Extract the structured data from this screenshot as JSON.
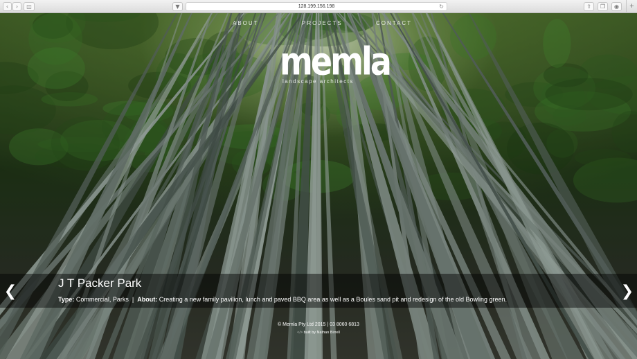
{
  "browser": {
    "url": "128.199.156.198",
    "icons": {
      "back": "chevron-left-icon",
      "forward": "chevron-right-icon",
      "sidebar": "sidebar-icon",
      "shield": "shield-icon",
      "reload": "reload-icon",
      "share": "share-icon",
      "tabs": "tabs-icon",
      "download": "download-icon",
      "new_tab": "plus-icon"
    }
  },
  "nav": {
    "about": "ABOUT",
    "projects": "PROJECTS",
    "contact": "CONTACT"
  },
  "logo": {
    "word": "memla",
    "tagline": "landscape architects"
  },
  "slide": {
    "title": "J T Packer Park",
    "type_label": "Type:",
    "type_value": "Commercial, Parks",
    "separator": "|",
    "about_label": "About:",
    "about_value": "Creating a new family pavilion, lunch and paved BBQ area as well as a Boules sand pit and redesign of the old Bowling green."
  },
  "controls": {
    "prev_icon": "chevron-left-icon",
    "next_icon": "chevron-right-icon"
  },
  "footer": {
    "copyright": "© Memla Pty Ltd 2015 | 03 8060 6813",
    "code_mark": "</>",
    "built_by": "built by Nathan Birrell"
  }
}
